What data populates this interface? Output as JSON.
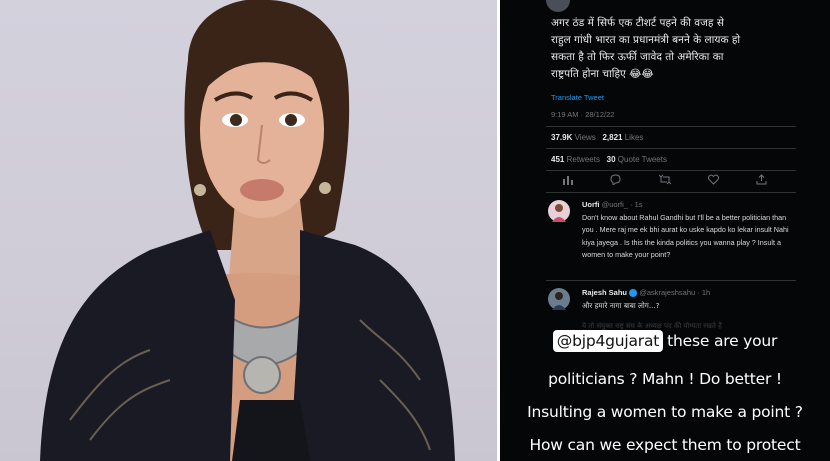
{
  "tweet": {
    "text": "अगर ठंड में सिर्फ एक टीशर्ट पहने की वजह से\nराहुल गांधी भारत का प्रधानमंत्री बनने के लायक हो\nसकता है तो फिर ऊर्फी जावेद तो अमेरिका का\nराष्ट्रपति होना चाहिए 😂😂",
    "translate_label": "Translate Tweet",
    "time": "9:19 AM",
    "date": "28/12/22",
    "views_count": "37.9K",
    "views_label": "Views",
    "likes_count": "2,821",
    "likes_label": "Likes",
    "retweets_count": "451",
    "retweets_label": "Retweets",
    "quotes_count": "30",
    "quotes_label": "Quote Tweets"
  },
  "actions": {
    "analytics_icon": "bar-chart-icon",
    "reply_icon": "reply-icon",
    "retweet_icon": "retweet-icon",
    "like_icon": "heart-icon",
    "share_icon": "share-icon"
  },
  "replies": [
    {
      "name": "Uorfi",
      "handle": "@uorfi_ · 1s",
      "text": "Don't know about Rahul Gandhi but I'll be a better politician than you . Mere raj me ek bhi aurat ko uske kapdo ko lekar insult Nahi kiya jayega . Is this the kinda politics you wanna play ? Insult a women to make your point?"
    },
    {
      "name": "Rajesh Sahu",
      "handle": "@askrajeshsahu · 1h",
      "text": "और हमारे नागा बाबा लोग...?"
    }
  ],
  "faint_line": "ये तो संयुक्त राष्ट्र संघ के अध्यक्ष पद की योग्यता रखते हैं",
  "caption": {
    "mention": "@bjp4gujarat",
    "line1_rest": "these are your",
    "line2": "politicians ? Mahn ! Do better !",
    "line3": "Insulting  a women to make a point ?",
    "line4": "How can we expect them to protect"
  },
  "colors": {
    "background": "#050608",
    "text": "#e7e9ea",
    "muted": "#71767b",
    "link": "#1d9bf0",
    "photo_bg": "#d0cdd8"
  }
}
